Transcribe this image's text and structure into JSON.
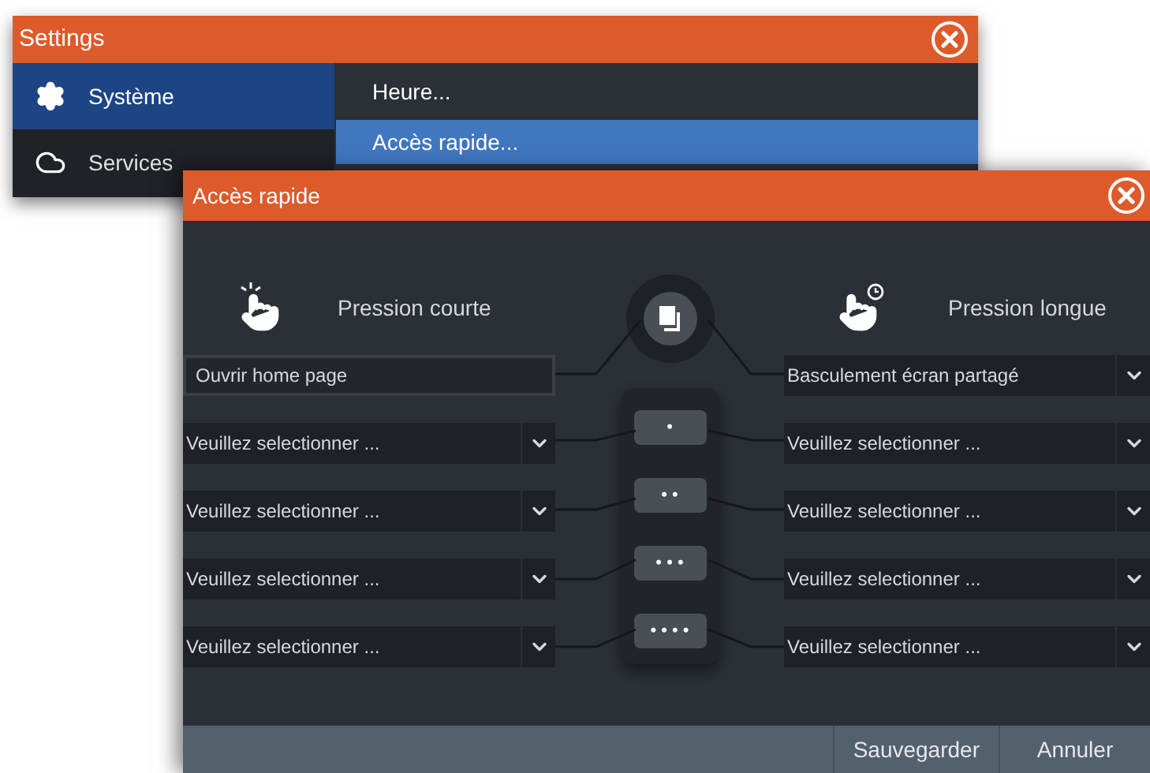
{
  "settings_window": {
    "title": "Settings",
    "sidebar": [
      {
        "label": "Système",
        "selected": true
      },
      {
        "label": "Services",
        "selected": false
      }
    ],
    "submenu": [
      {
        "label": "Heure...",
        "selected": false
      },
      {
        "label": "Accès rapide...",
        "selected": true
      }
    ]
  },
  "dialog": {
    "title": "Accès rapide",
    "short_press": {
      "heading": "Pression courte",
      "slots": [
        {
          "kind": "field",
          "value": "Ouvrir home page"
        },
        {
          "kind": "dropdown",
          "value": "Veuillez selectionner ..."
        },
        {
          "kind": "dropdown",
          "value": "Veuillez selectionner ..."
        },
        {
          "kind": "dropdown",
          "value": "Veuillez selectionner ..."
        },
        {
          "kind": "dropdown",
          "value": "Veuillez selectionner ..."
        }
      ]
    },
    "long_press": {
      "heading": "Pression longue",
      "slots": [
        {
          "kind": "dropdown",
          "value": "Basculement écran partagé"
        },
        {
          "kind": "dropdown",
          "value": "Veuillez selectionner ..."
        },
        {
          "kind": "dropdown",
          "value": "Veuillez selectionner ..."
        },
        {
          "kind": "dropdown",
          "value": "Veuillez selectionner ..."
        },
        {
          "kind": "dropdown",
          "value": "Veuillez selectionner ..."
        }
      ]
    },
    "keys": [
      "•",
      "• •",
      "• • •",
      "• • • •"
    ],
    "buttons": [
      "Sauvegarder",
      "Annuler"
    ]
  }
}
